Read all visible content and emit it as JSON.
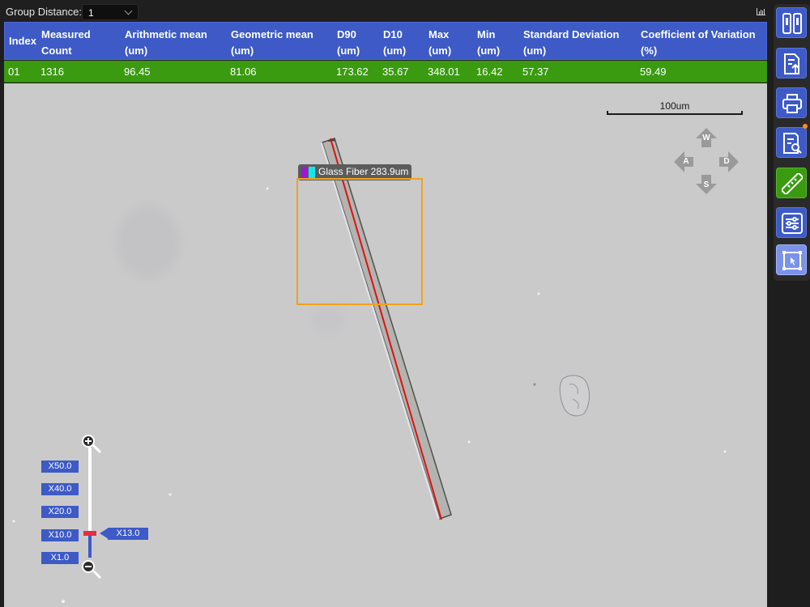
{
  "toolbar_top": {
    "group_distance_label": "Group Distance:",
    "group_distance_value": "1",
    "chart_icon": "bar-chart-icon"
  },
  "stats_table": {
    "headers": [
      {
        "line1": "Index",
        "line2": ""
      },
      {
        "line1": "Measured",
        "line2": "Count"
      },
      {
        "line1": "Arithmetic mean",
        "line2": "(um)"
      },
      {
        "line1": "Geometric mean",
        "line2": "(um)"
      },
      {
        "line1": "D90",
        "line2": "(um)"
      },
      {
        "line1": "D10",
        "line2": "(um)"
      },
      {
        "line1": "Max",
        "line2": "(um)"
      },
      {
        "line1": "Min",
        "line2": "(um)"
      },
      {
        "line1": "Standard Deviation",
        "line2": "(um)"
      },
      {
        "line1": "Coefficient of Variation",
        "line2": "(%)"
      }
    ],
    "rows": [
      [
        "01",
        "1316",
        "96.45",
        "81.06",
        "173.62",
        "35.67",
        "348.01",
        "16.42",
        "57.37",
        "59.49"
      ]
    ],
    "header_color": "#3d5ac6",
    "row_color": "#3a9b10"
  },
  "viewport": {
    "scale_bar_label": "100um",
    "measurement_label": "Glass Fiber 283.9um",
    "measurement_colors": [
      "#9a18d0",
      "#14e6f0"
    ],
    "line_color": "#e01010",
    "roi_color": "#f0a21a",
    "nav_keys": [
      "W",
      "A",
      "D",
      "S"
    ]
  },
  "zoom_control": {
    "levels": [
      "X50.0",
      "X40.0",
      "X20.0",
      "X10.0",
      "X1.0"
    ],
    "current": "X13.0",
    "zoom_in_icon": "zoom-in-icon",
    "zoom_out_icon": "zoom-out-icon"
  },
  "right_toolbar": {
    "tools": [
      {
        "name": "compare-icon",
        "state": "normal"
      },
      {
        "name": "export-report-icon",
        "state": "normal"
      },
      {
        "name": "print-icon",
        "state": "normal"
      },
      {
        "name": "report-search-icon",
        "state": "normal"
      },
      {
        "name": "ruler-icon",
        "state": "active"
      },
      {
        "name": "settings-sliders-icon",
        "state": "normal"
      },
      {
        "name": "roi-select-icon",
        "state": "highlight"
      }
    ],
    "accent_color": "#ff8c1a"
  }
}
